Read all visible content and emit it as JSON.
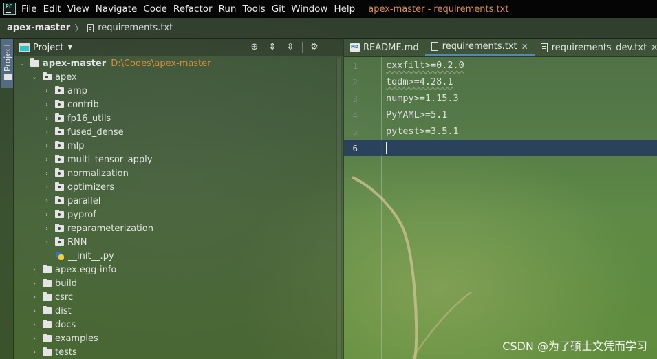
{
  "menubar": {
    "logo_text": "PC",
    "items": [
      "File",
      "Edit",
      "View",
      "Navigate",
      "Code",
      "Refactor",
      "Run",
      "Tools",
      "Git",
      "Window",
      "Help"
    ],
    "window_title": "apex-master - requirements.txt"
  },
  "breadcrumb": {
    "root": "apex-master",
    "file": "requirements.txt"
  },
  "toolstrip": {
    "project_tab": "Project"
  },
  "project_panel": {
    "title": "Project",
    "tree": [
      {
        "label": "apex-master",
        "path": "D:\\Codes\\apex-master",
        "depth": 0,
        "expanded": true,
        "type": "folder"
      },
      {
        "label": "apex",
        "depth": 1,
        "expanded": true,
        "type": "package"
      },
      {
        "label": "amp",
        "depth": 2,
        "expanded": false,
        "type": "package"
      },
      {
        "label": "contrib",
        "depth": 2,
        "expanded": false,
        "type": "package"
      },
      {
        "label": "fp16_utils",
        "depth": 2,
        "expanded": false,
        "type": "package"
      },
      {
        "label": "fused_dense",
        "depth": 2,
        "expanded": false,
        "type": "package"
      },
      {
        "label": "mlp",
        "depth": 2,
        "expanded": false,
        "type": "package"
      },
      {
        "label": "multi_tensor_apply",
        "depth": 2,
        "expanded": false,
        "type": "package"
      },
      {
        "label": "normalization",
        "depth": 2,
        "expanded": false,
        "type": "package"
      },
      {
        "label": "optimizers",
        "depth": 2,
        "expanded": false,
        "type": "package"
      },
      {
        "label": "parallel",
        "depth": 2,
        "expanded": false,
        "type": "package"
      },
      {
        "label": "pyprof",
        "depth": 2,
        "expanded": false,
        "type": "package"
      },
      {
        "label": "reparameterization",
        "depth": 2,
        "expanded": false,
        "type": "package"
      },
      {
        "label": "RNN",
        "depth": 2,
        "expanded": false,
        "type": "package"
      },
      {
        "label": "__init__.py",
        "depth": 2,
        "type": "python"
      },
      {
        "label": "apex.egg-info",
        "depth": 1,
        "expanded": false,
        "type": "folder"
      },
      {
        "label": "build",
        "depth": 1,
        "expanded": false,
        "type": "folder"
      },
      {
        "label": "csrc",
        "depth": 1,
        "expanded": false,
        "type": "folder"
      },
      {
        "label": "dist",
        "depth": 1,
        "expanded": false,
        "type": "folder"
      },
      {
        "label": "docs",
        "depth": 1,
        "expanded": false,
        "type": "folder"
      },
      {
        "label": "examples",
        "depth": 1,
        "expanded": false,
        "type": "folder"
      },
      {
        "label": "tests",
        "depth": 1,
        "expanded": false,
        "type": "folder"
      }
    ]
  },
  "tabs": [
    {
      "label": "README.md",
      "icon": "markdown-icon",
      "active": false
    },
    {
      "label": "requirements.txt",
      "icon": "text-file-icon",
      "active": true
    },
    {
      "label": "requirements_dev.txt",
      "icon": "text-file-icon",
      "active": false
    }
  ],
  "editor": {
    "lines": [
      {
        "number": "1",
        "text": "cxxfilt>=0.2.0"
      },
      {
        "number": "2",
        "text": "tqdm>=4.28.1"
      },
      {
        "number": "3",
        "text": "numpy>=1.15.3"
      },
      {
        "number": "4",
        "text": "PyYAML>=5.1"
      },
      {
        "number": "5",
        "text": "pytest>=3.5.1"
      },
      {
        "number": "6",
        "text": ""
      }
    ],
    "current_line": 6
  },
  "watermark": "CSDN @为了硕士文凭而学习",
  "colors": {
    "menubar_bg": "#050505",
    "window_title": "#e08b4b",
    "path_text": "#d88e3a",
    "active_tab_underline": "#4a88c7",
    "current_line_bg": "#23375f"
  }
}
